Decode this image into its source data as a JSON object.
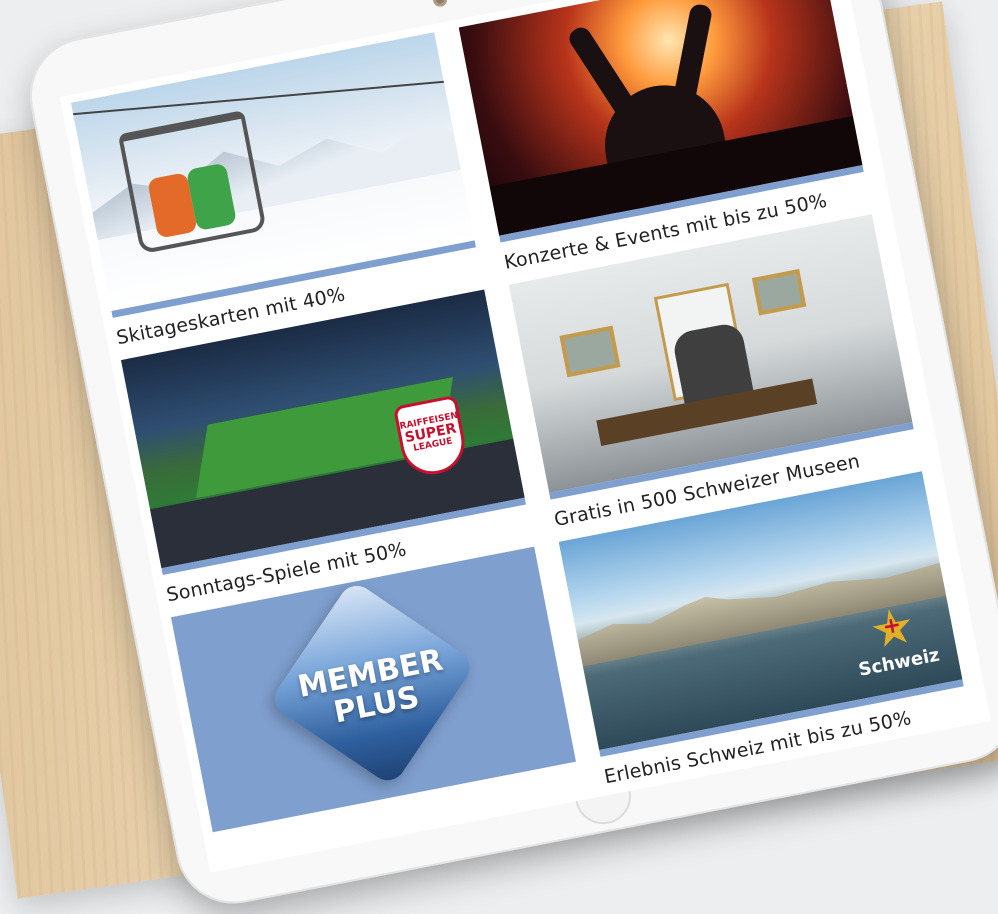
{
  "tiles": {
    "ski": {
      "caption": "Skitageskarten mit 40%"
    },
    "concerts": {
      "caption": "Konzerte & Events mit bis zu 50%"
    },
    "football": {
      "caption": "Sonntags-Spiele mit 50%",
      "badge_top": "RAIFFEISEN",
      "badge_main": "SUPER",
      "badge_bottom": "LEAGUE"
    },
    "museums": {
      "caption": "Gratis in 500 Schweizer Museen"
    },
    "memberplus": {
      "line1": "MEMBER",
      "line2": "PLUS"
    },
    "switzerland": {
      "caption": "Erlebnis Schweiz mit bis zu 50%",
      "logo_text": "Schweiz"
    }
  },
  "colors": {
    "accent": "#7f9fcf",
    "board": "#e3c9a3",
    "tablet": "#f8f8f8"
  }
}
